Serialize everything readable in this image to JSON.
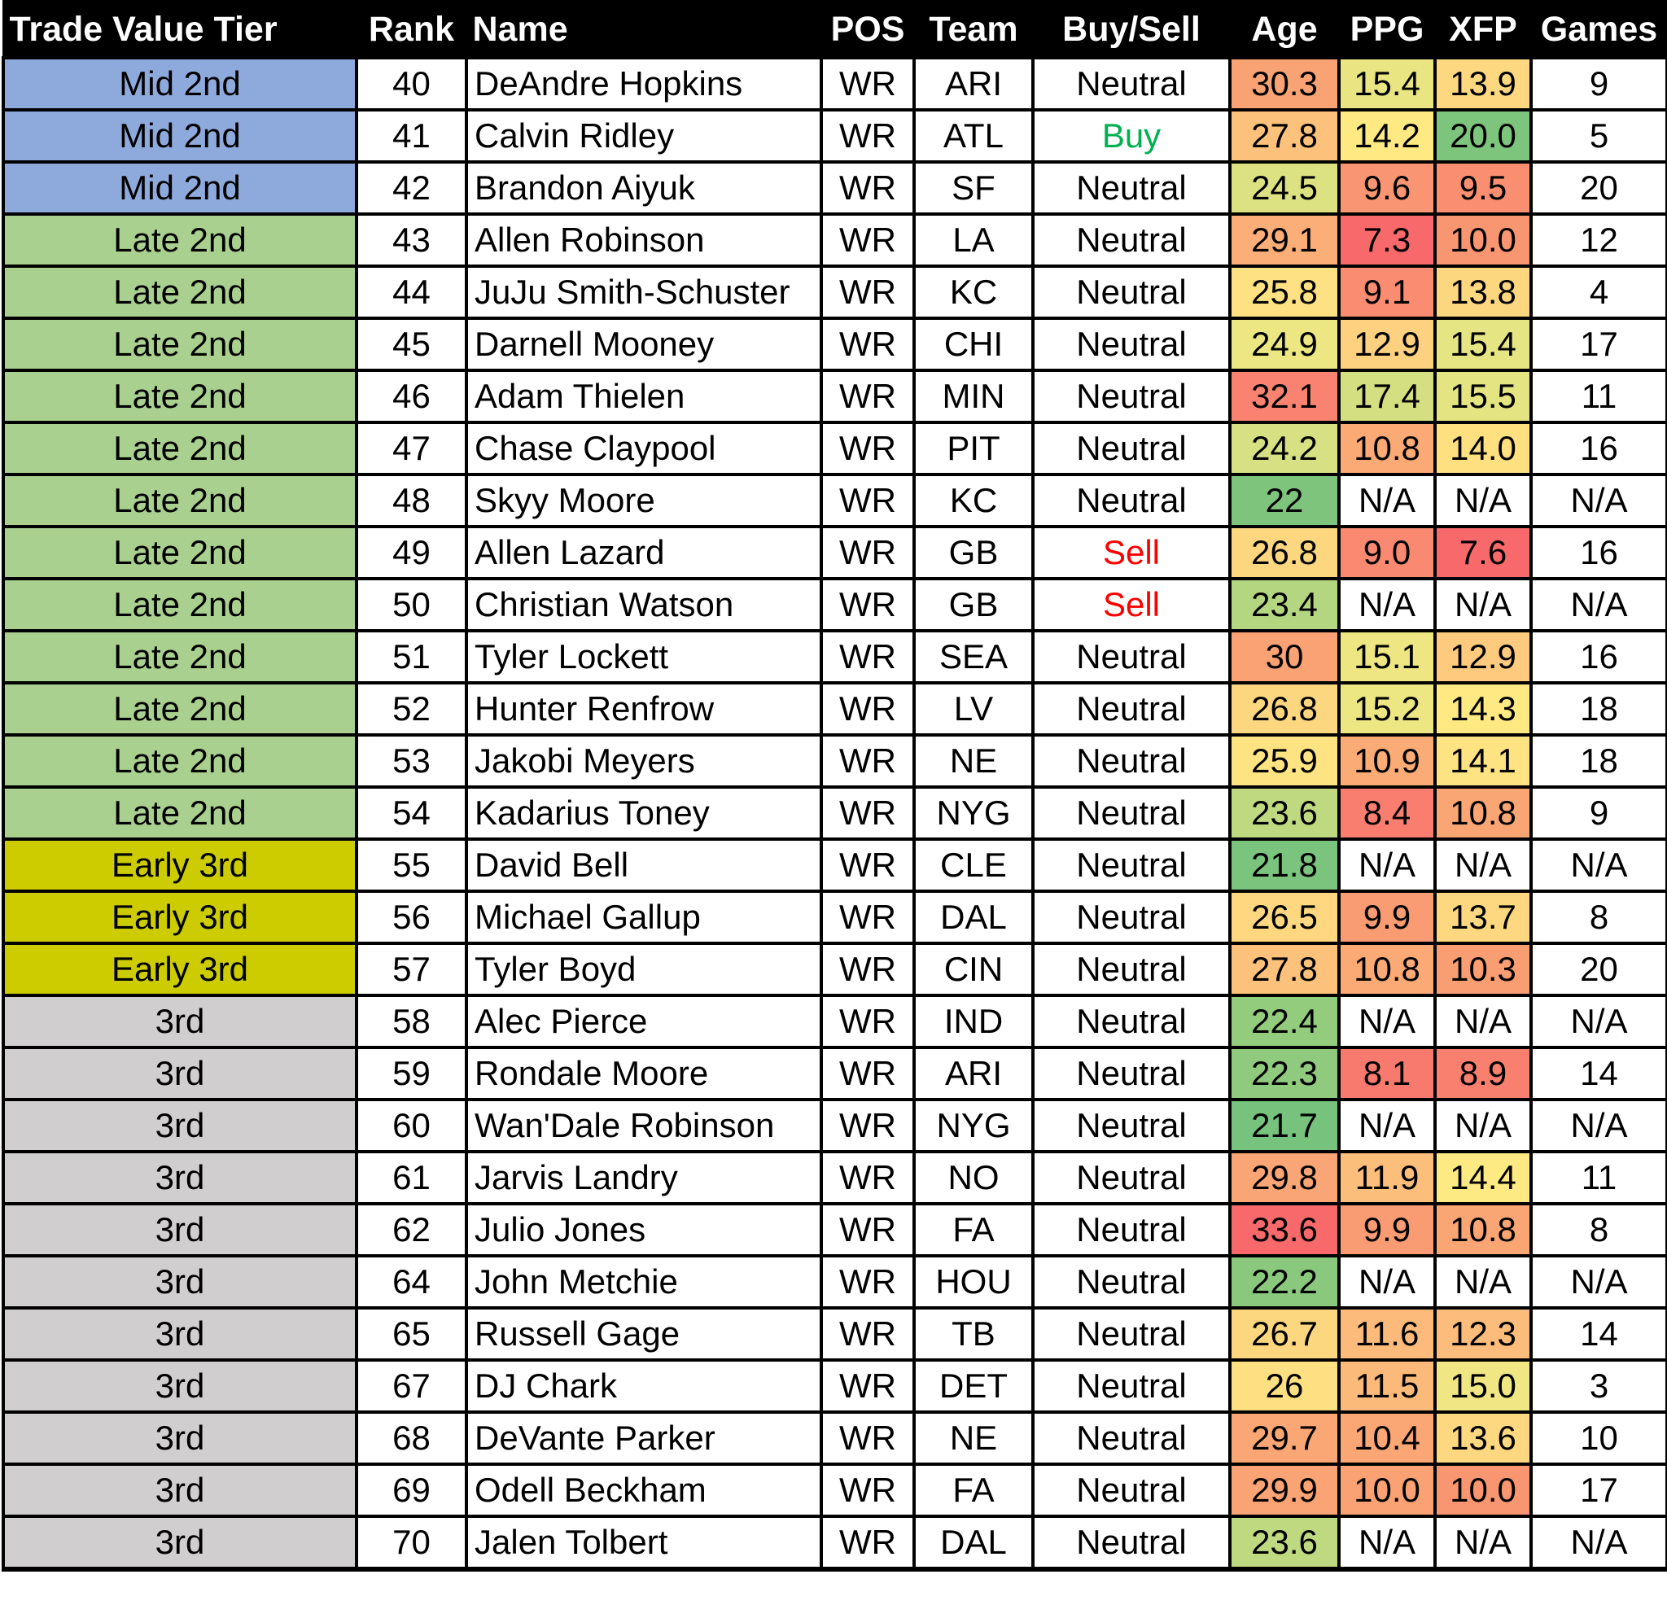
{
  "table": {
    "headers": {
      "tier": "Trade Value Tier",
      "rank": "Rank",
      "name": "Name",
      "pos": "POS",
      "team": "Team",
      "buysell": "Buy/Sell",
      "age": "Age",
      "ppg": "PPG",
      "xfp": "XFP",
      "games": "Games"
    },
    "tier_colors": {
      "Mid 2nd": "#8EA9DB",
      "Late 2nd": "#A9D08E",
      "Early 3rd": "#CCCC00",
      "3rd": "#D0CECE"
    },
    "buysell_colors": {
      "Buy": "#00B050",
      "Sell": "#FF0000",
      "Neutral": "#000000"
    },
    "rows": [
      {
        "tier": "Mid 2nd",
        "rank": "40",
        "name": "DeAndre Hopkins",
        "pos": "WR",
        "team": "ARI",
        "buysell": "Neutral",
        "age": "30.3",
        "ppg": "15.4",
        "xfp": "13.9",
        "games": "9",
        "age_color": "#F9A374",
        "ppg_color": "#E9E583",
        "xfp_color": "#FDD880"
      },
      {
        "tier": "Mid 2nd",
        "rank": "41",
        "name": "Calvin Ridley",
        "pos": "WR",
        "team": "ATL",
        "buysell": "Buy",
        "age": "27.8",
        "ppg": "14.2",
        "xfp": "20.0",
        "games": "5",
        "age_color": "#FCC27C",
        "ppg_color": "#FEE983",
        "xfp_color": "#7DC47D"
      },
      {
        "tier": "Mid 2nd",
        "rank": "42",
        "name": "Brandon Aiyuk",
        "pos": "WR",
        "team": "SF",
        "buysell": "Neutral",
        "age": "24.5",
        "ppg": "9.6",
        "xfp": "9.5",
        "games": "20",
        "age_color": "#DCE182",
        "ppg_color": "#F99572",
        "xfp_color": "#F98E71"
      },
      {
        "tier": "Late 2nd",
        "rank": "43",
        "name": "Allen Robinson",
        "pos": "WR",
        "team": "LA",
        "buysell": "Neutral",
        "age": "29.1",
        "ppg": "7.3",
        "xfp": "10.0",
        "games": "12",
        "age_color": "#FBAE77",
        "ppg_color": "#F8696B",
        "xfp_color": "#F99672"
      },
      {
        "tier": "Late 2nd",
        "rank": "44",
        "name": "JuJu Smith-Schuster",
        "pos": "WR",
        "team": "KC",
        "buysell": "Neutral",
        "age": "25.8",
        "ppg": "9.1",
        "xfp": "13.8",
        "games": "4",
        "age_color": "#FEE182",
        "ppg_color": "#F98C71",
        "xfp_color": "#FDD680"
      },
      {
        "tier": "Late 2nd",
        "rank": "45",
        "name": "Darnell Mooney",
        "pos": "WR",
        "team": "CHI",
        "buysell": "Neutral",
        "age": "24.9",
        "ppg": "12.9",
        "xfp": "15.4",
        "games": "17",
        "age_color": "#ECE783",
        "ppg_color": "#FDD17F",
        "xfp_color": "#E6E583"
      },
      {
        "tier": "Late 2nd",
        "rank": "46",
        "name": "Adam Thielen",
        "pos": "WR",
        "team": "MIN",
        "buysell": "Neutral",
        "age": "32.1",
        "ppg": "17.4",
        "xfp": "15.5",
        "games": "11",
        "age_color": "#F98370",
        "ppg_color": "#D4DF82",
        "xfp_color": "#E4E483"
      },
      {
        "tier": "Late 2nd",
        "rank": "47",
        "name": "Chase Claypool",
        "pos": "WR",
        "team": "PIT",
        "buysell": "Neutral",
        "age": "24.2",
        "ppg": "10.8",
        "xfp": "14.0",
        "games": "16",
        "age_color": "#D7E082",
        "ppg_color": "#FBAA76",
        "xfp_color": "#FEE081"
      },
      {
        "tier": "Late 2nd",
        "rank": "48",
        "name": "Skyy Moore",
        "pos": "WR",
        "team": "KC",
        "buysell": "Neutral",
        "age": "22",
        "ppg": "N/A",
        "xfp": "N/A",
        "games": "N/A",
        "age_color": "#7FC47D",
        "ppg_color": "#FFFFFF",
        "xfp_color": "#FFFFFF"
      },
      {
        "tier": "Late 2nd",
        "rank": "49",
        "name": "Allen Lazard",
        "pos": "WR",
        "team": "GB",
        "buysell": "Sell",
        "age": "26.8",
        "ppg": "9.0",
        "xfp": "7.6",
        "games": "16",
        "age_color": "#FDD680",
        "ppg_color": "#F98A71",
        "xfp_color": "#F8696B"
      },
      {
        "tier": "Late 2nd",
        "rank": "50",
        "name": "Christian Watson",
        "pos": "WR",
        "team": "GB",
        "buysell": "Sell",
        "age": "23.4",
        "ppg": "N/A",
        "xfp": "N/A",
        "games": "N/A",
        "age_color": "#B5D680",
        "ppg_color": "#FFFFFF",
        "xfp_color": "#FFFFFF"
      },
      {
        "tier": "Late 2nd",
        "rank": "51",
        "name": "Tyler Lockett",
        "pos": "WR",
        "team": "SEA",
        "buysell": "Neutral",
        "age": "30",
        "ppg": "15.1",
        "xfp": "12.9",
        "games": "16",
        "age_color": "#FAA274",
        "ppg_color": "#EEE683",
        "xfp_color": "#FDCA7E"
      },
      {
        "tier": "Late 2nd",
        "rank": "52",
        "name": "Hunter Renfrow",
        "pos": "WR",
        "team": "LV",
        "buysell": "Neutral",
        "age": "26.8",
        "ppg": "15.2",
        "xfp": "14.3",
        "games": "18",
        "age_color": "#FDD680",
        "ppg_color": "#ECE683",
        "xfp_color": "#FEE983"
      },
      {
        "tier": "Late 2nd",
        "rank": "53",
        "name": "Jakobi Meyers",
        "pos": "WR",
        "team": "NE",
        "buysell": "Neutral",
        "age": "25.9",
        "ppg": "10.9",
        "xfp": "14.1",
        "games": "18",
        "age_color": "#FEE382",
        "ppg_color": "#FBAC76",
        "xfp_color": "#FEE382"
      },
      {
        "tier": "Late 2nd",
        "rank": "54",
        "name": "Kadarius Toney",
        "pos": "WR",
        "team": "NYG",
        "buysell": "Neutral",
        "age": "23.6",
        "ppg": "8.4",
        "xfp": "10.8",
        "games": "9",
        "age_color": "#BFD981",
        "ppg_color": "#F97E6F",
        "xfp_color": "#FAA574"
      },
      {
        "tier": "Early 3rd",
        "rank": "55",
        "name": "David Bell",
        "pos": "WR",
        "team": "CLE",
        "buysell": "Neutral",
        "age": "21.8",
        "ppg": "N/A",
        "xfp": "N/A",
        "games": "N/A",
        "age_color": "#7BC47D",
        "ppg_color": "#FFFFFF",
        "xfp_color": "#FFFFFF"
      },
      {
        "tier": "Early 3rd",
        "rank": "56",
        "name": "Michael Gallup",
        "pos": "WR",
        "team": "DAL",
        "buysell": "Neutral",
        "age": "26.5",
        "ppg": "9.9",
        "xfp": "13.7",
        "games": "8",
        "age_color": "#FED780",
        "ppg_color": "#F99C73",
        "xfp_color": "#FDD880"
      },
      {
        "tier": "Early 3rd",
        "rank": "57",
        "name": "Tyler Boyd",
        "pos": "WR",
        "team": "CIN",
        "buysell": "Neutral",
        "age": "27.8",
        "ppg": "10.8",
        "xfp": "10.3",
        "games": "20",
        "age_color": "#FCC27C",
        "ppg_color": "#FBAA76",
        "xfp_color": "#F99D73"
      },
      {
        "tier": "3rd",
        "rank": "58",
        "name": "Alec Pierce",
        "pos": "WR",
        "team": "IND",
        "buysell": "Neutral",
        "age": "22.4",
        "ppg": "N/A",
        "xfp": "N/A",
        "games": "N/A",
        "age_color": "#94CC7E",
        "ppg_color": "#FFFFFF",
        "xfp_color": "#FFFFFF"
      },
      {
        "tier": "3rd",
        "rank": "59",
        "name": "Rondale Moore",
        "pos": "WR",
        "team": "ARI",
        "buysell": "Neutral",
        "age": "22.3",
        "ppg": "8.1",
        "xfp": "8.9",
        "games": "14",
        "age_color": "#90CA7E",
        "ppg_color": "#F8796D",
        "xfp_color": "#F97F6F"
      },
      {
        "tier": "3rd",
        "rank": "60",
        "name": "Wan'Dale Robinson",
        "pos": "WR",
        "team": "NYG",
        "buysell": "Neutral",
        "age": "21.7",
        "ppg": "N/A",
        "xfp": "N/A",
        "games": "N/A",
        "age_color": "#77C27C",
        "ppg_color": "#FFFFFF",
        "xfp_color": "#FFFFFF"
      },
      {
        "tier": "3rd",
        "rank": "61",
        "name": "Jarvis Landry",
        "pos": "WR",
        "team": "NO",
        "buysell": "Neutral",
        "age": "29.8",
        "ppg": "11.9",
        "xfp": "14.4",
        "games": "11",
        "age_color": "#FAA575",
        "ppg_color": "#FCBE7B",
        "xfp_color": "#FEEA83"
      },
      {
        "tier": "3rd",
        "rank": "62",
        "name": "Julio Jones",
        "pos": "WR",
        "team": "FA",
        "buysell": "Neutral",
        "age": "33.6",
        "ppg": "9.9",
        "xfp": "10.8",
        "games": "8",
        "age_color": "#F8696B",
        "ppg_color": "#F99C73",
        "xfp_color": "#FAA574"
      },
      {
        "tier": "3rd",
        "rank": "64",
        "name": "John Metchie",
        "pos": "WR",
        "team": "HOU",
        "buysell": "Neutral",
        "age": "22.2",
        "ppg": "N/A",
        "xfp": "N/A",
        "games": "N/A",
        "age_color": "#8AC87E",
        "ppg_color": "#FFFFFF",
        "xfp_color": "#FFFFFF"
      },
      {
        "tier": "3rd",
        "rank": "65",
        "name": "Russell Gage",
        "pos": "WR",
        "team": "TB",
        "buysell": "Neutral",
        "age": "26.7",
        "ppg": "11.6",
        "xfp": "12.3",
        "games": "14",
        "age_color": "#FDD780",
        "ppg_color": "#FCBB7A",
        "xfp_color": "#FCBC7B"
      },
      {
        "tier": "3rd",
        "rank": "67",
        "name": "DJ Chark",
        "pos": "WR",
        "team": "DET",
        "buysell": "Neutral",
        "age": "26",
        "ppg": "11.5",
        "xfp": "15.0",
        "games": "3",
        "age_color": "#FEDF81",
        "ppg_color": "#FCBA7A",
        "xfp_color": "#F0E683"
      },
      {
        "tier": "3rd",
        "rank": "68",
        "name": "DeVante Parker",
        "pos": "WR",
        "team": "NE",
        "buysell": "Neutral",
        "age": "29.7",
        "ppg": "10.4",
        "xfp": "13.6",
        "games": "10",
        "age_color": "#FAA775",
        "ppg_color": "#FAA675",
        "xfp_color": "#FDD880"
      },
      {
        "tier": "3rd",
        "rank": "69",
        "name": "Odell Beckham",
        "pos": "WR",
        "team": "FA",
        "buysell": "Neutral",
        "age": "29.9",
        "ppg": "10.0",
        "xfp": "10.0",
        "games": "17",
        "age_color": "#FAA374",
        "ppg_color": "#FAA274",
        "xfp_color": "#F99672"
      },
      {
        "tier": "3rd",
        "rank": "70",
        "name": "Jalen Tolbert",
        "pos": "WR",
        "team": "DAL",
        "buysell": "Neutral",
        "age": "23.6",
        "ppg": "N/A",
        "xfp": "N/A",
        "games": "N/A",
        "age_color": "#BFD981",
        "ppg_color": "#FFFFFF",
        "xfp_color": "#FFFFFF"
      }
    ]
  }
}
